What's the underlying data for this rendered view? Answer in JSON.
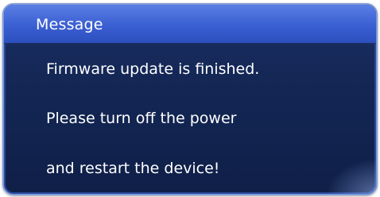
{
  "dialog": {
    "title": "Message",
    "lines": [
      "Firmware update is finished.",
      "Please turn off the power",
      "and restart the device!"
    ]
  }
}
